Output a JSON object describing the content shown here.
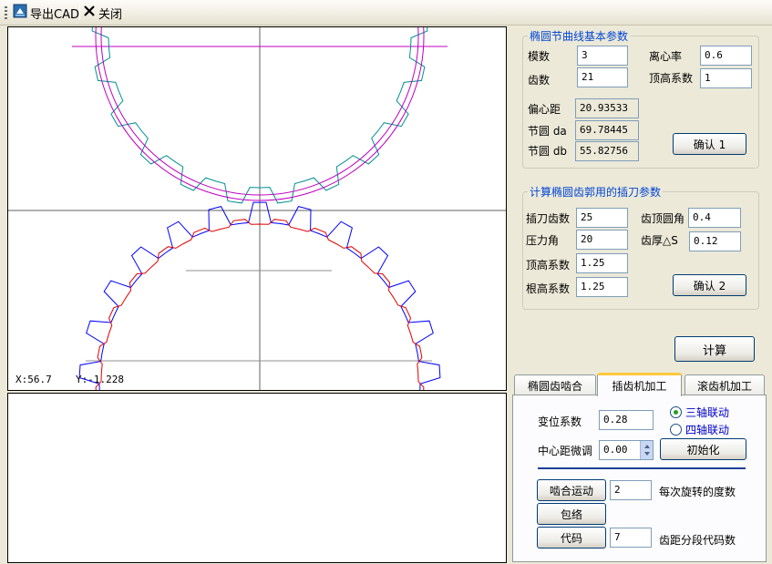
{
  "toolbar": {
    "export_label": "导出CAD",
    "close_label": "关闭"
  },
  "canvas": {
    "coord_x": "X:56.7",
    "coord_y": "Y:-1.228"
  },
  "group1": {
    "title": "椭圆节曲线基本参数",
    "module_label": "模数",
    "module_value": "3",
    "eccentricity_label": "离心率",
    "eccentricity_value": "0.6",
    "teeth_label": "齿数",
    "teeth_value": "21",
    "addendum_label": "顶高系数",
    "addendum_value": "1",
    "offset_label": "偏心距",
    "offset_value": "20.93533",
    "pitch_da_label": "节圆 da",
    "pitch_da_value": "69.78445",
    "pitch_db_label": "节圆 db",
    "pitch_db_value": "55.82756",
    "confirm_label": "确认 1"
  },
  "group2": {
    "title": "计算椭圆齿郭用的插刀参数",
    "cutter_teeth_label": "插刀齿数",
    "cutter_teeth_value": "25",
    "tip_radius_label": "齿顶圆角",
    "tip_radius_value": "0.4",
    "pressure_angle_label": "压力角",
    "pressure_angle_value": "20",
    "tooth_thickness_label": "齿厚△S",
    "tooth_thickness_value": "0.12",
    "addendum_coef_label": "顶高系数",
    "addendum_coef_value": "1.25",
    "dedendum_coef_label": "根高系数",
    "dedendum_coef_value": "1.25",
    "confirm_label": "确认 2"
  },
  "calc_label": "计算",
  "tabs": [
    {
      "label": "椭圆齿啮合"
    },
    {
      "label": "插齿机加工"
    },
    {
      "label": "滚齿机加工"
    }
  ],
  "panel": {
    "shift_label": "变位系数",
    "shift_value": "0.28",
    "center_adjust_label": "中心距微调",
    "center_adjust_value": "0.00",
    "radio_three_axis": "三轴联动",
    "radio_four_axis": "四轴联动",
    "init_label": "初始化",
    "mesh_motion_label": "啮合运动",
    "mesh_step_value": "2",
    "mesh_step_unit": "每次旋转的度数",
    "envelope_label": "包络",
    "code_label": "代码",
    "code_value": "7",
    "code_unit": "齿距分段代码数"
  },
  "colors": {
    "title_blue": "#0046d5",
    "radio_blue": "#0000c8",
    "upper_gear": "#009090",
    "upper_pitch": "#c000c0",
    "lower_gear": "#0000ff",
    "lower_fillet": "#e00000",
    "axis": "#606060"
  }
}
